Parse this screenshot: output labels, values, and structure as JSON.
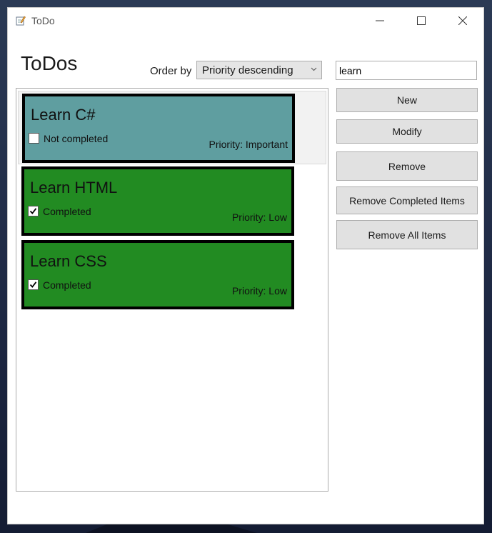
{
  "window": {
    "title": "ToDo"
  },
  "header": {
    "title": "ToDos"
  },
  "order": {
    "label": "Order by",
    "selected": "Priority descending"
  },
  "search": {
    "value": "learn"
  },
  "colors": {
    "priority_important": "#5f9ea0",
    "priority_low": "#228b22"
  },
  "todos": [
    {
      "title": "Learn C#",
      "status": "Not completed",
      "completed": false,
      "priority": "Priority: Important",
      "color": "#5f9ea0"
    },
    {
      "title": "Learn HTML",
      "status": "Completed",
      "completed": true,
      "priority": "Priority: Low",
      "color": "#228b22"
    },
    {
      "title": "Learn CSS",
      "status": "Completed",
      "completed": true,
      "priority": "Priority: Low",
      "color": "#228b22"
    }
  ],
  "actions": {
    "new": "New",
    "modify": "Modify",
    "remove": "Remove",
    "remove_completed": "Remove Completed Items",
    "remove_all": "Remove All Items"
  }
}
